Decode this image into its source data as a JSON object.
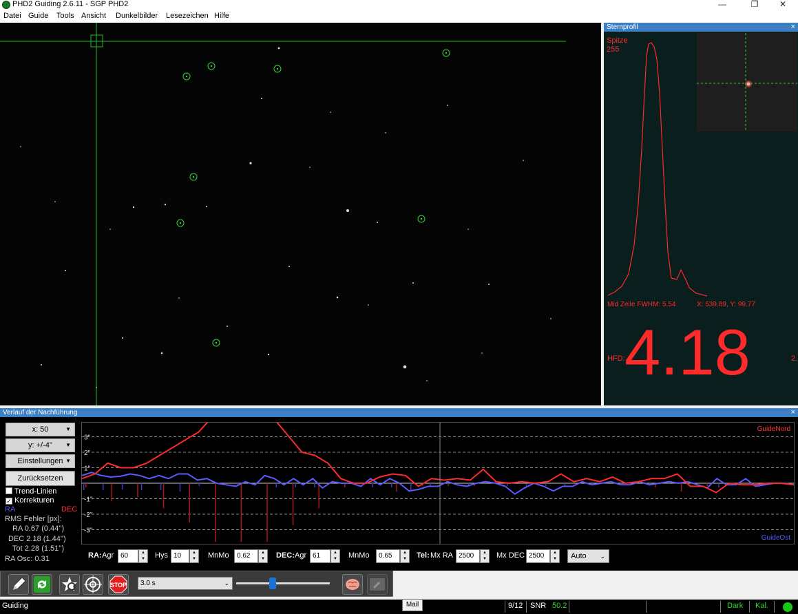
{
  "window": {
    "title": "PHD2 Guiding 2.6.11 - SGP PHD2",
    "minimize": "—",
    "restore": "❐",
    "close": "✕"
  },
  "menu": [
    "Datei",
    "Guide",
    "Tools",
    "Ansicht",
    "Dunkelbilder",
    "Lesezeichen",
    "Hilfe"
  ],
  "profile": {
    "title": "Sternprofil",
    "close": "×",
    "peak_label": "Spitze",
    "peak_value": "255",
    "fwhm": "Mid Zeile FWHM: 5.54",
    "coords": "X: 539.89, Y: 99.77",
    "hfd_label": "HFD:",
    "hfd_value": "4.18",
    "hfd_extra": "2."
  },
  "history": {
    "title": "Verlauf der Nachführung",
    "close": "×",
    "x_scale": "x: 50",
    "y_scale": "y: +/-4''",
    "settings": "Einstellungen",
    "reset": "Zurücksetzen",
    "trend_lines": "Trend-Linien",
    "trend_checked": false,
    "corrections": "Korrekturen",
    "corrections_checked": true,
    "ra_label": "RA",
    "dec_label": "DEC",
    "rms_header": "RMS Fehler [px]:",
    "rms_ra": "RA  0.67 (0.44'')",
    "rms_dec": "DEC  2.18 (1.44'')",
    "rms_tot": "Tot  2.28 (1.51'')",
    "ra_osc": "RA Osc: 0.31",
    "guide_north": "GuideNord",
    "guide_east": "GuideOst",
    "params": {
      "ra_label": "RA:",
      "ra_agr_label": "Agr",
      "ra_agr": "60",
      "hys_label": "Hys",
      "hys": "10",
      "ra_mnmo_label": "MnMo",
      "ra_mnmo": "0.62",
      "dec_label": "DEC:",
      "dec_agr_label": "Agr",
      "dec_agr": "61",
      "dec_mnmo_label": "MnMo",
      "dec_mnmo": "0.65",
      "tel_label": "Tel:",
      "mx_ra_label": "Mx RA",
      "mx_ra": "2500",
      "mx_dec_label": "Mx DEC",
      "mx_dec": "2500",
      "dec_mode": "Auto"
    }
  },
  "chart_data": {
    "type": "line",
    "y_ticks": [
      "3''",
      "2''",
      "1''",
      "-1''",
      "-2''",
      "-3''"
    ],
    "ylim": [
      -4,
      4
    ],
    "series": [
      {
        "name": "RA",
        "color": "#5a5aff",
        "values": [
          0.5,
          0.7,
          0.5,
          0.4,
          0.45,
          0.6,
          0.5,
          0.3,
          0.5,
          0.3,
          0.6,
          0.6,
          0.2,
          0.3,
          0.0,
          -0.1,
          -0.2,
          0.1,
          -0.1,
          0.5,
          0.3,
          -0.1,
          0.3,
          -0.1,
          0.3,
          -0.3,
          0.1,
          0.0,
          0.0,
          -0.2,
          0.3,
          -0.1,
          0.3,
          0.0,
          -0.5,
          -0.4,
          -0.2,
          -0.2,
          0.1,
          -0.1,
          -0.2,
          0.0,
          0.1,
          0.0,
          -0.2,
          -0.7,
          -0.3,
          0.0,
          -0.2,
          -0.5,
          -0.2,
          -0.2,
          0.1,
          -0.1,
          0.0,
          0.1,
          -0.1,
          -0.1,
          0.1,
          -0.1,
          0.0,
          0.1,
          0.0,
          0.1,
          -0.1,
          -0.3,
          0.3,
          -0.1,
          -0.1,
          0.3,
          -0.2,
          -0.1,
          0.0,
          0.0,
          -0.1
        ]
      },
      {
        "name": "DEC",
        "color": "#ff2a2a",
        "values": [
          0.3,
          0.6,
          1.3,
          1.0,
          1.0,
          1.3,
          1.8,
          2.3,
          2.8,
          3.3,
          4.2,
          4.6,
          5.0,
          5.2,
          4.5,
          4.0,
          3.0,
          2.0,
          1.8,
          1.3,
          0.3,
          0.0,
          0.0,
          0.4,
          0.6,
          0.5,
          -0.2,
          0.3,
          0.2,
          0.3,
          0.2,
          0.9,
          0.1,
          0.0,
          0.1,
          0.0,
          0.1,
          0.6,
          0.1,
          0.3,
          0.1,
          0.4,
          0.0,
          0.1,
          0.3,
          0.3,
          0.6,
          -0.2,
          -0.2,
          -0.6,
          0.0,
          -0.1,
          -0.1,
          0.0,
          0.0,
          -0.1
        ]
      }
    ]
  },
  "toolbar": {
    "exposure": "3.0 s",
    "tooltip": "Mail"
  },
  "status": {
    "state": "Guiding",
    "frames": "9/12",
    "snr_label": "SNR",
    "snr_value": "50.2",
    "dark": "Dark",
    "cal": "Kal."
  }
}
